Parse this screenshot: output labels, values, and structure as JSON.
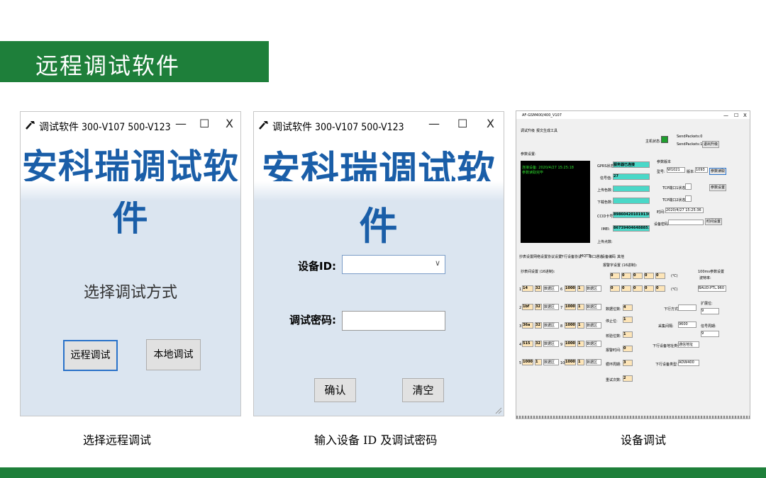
{
  "slide": {
    "title": "远程调试软件",
    "colors": {
      "band": "#1e7f3a",
      "window_bg": "#dbe5f0",
      "banner_text": "#1a5ea8",
      "focus": "#2a72c9"
    }
  },
  "window1": {
    "title": "调试软件  300-V107  500-V123",
    "banner": "安科瑞调试软件",
    "prompt": "选择调试方式",
    "remote_button": "远程调试",
    "local_button": "本地调试",
    "minimize": "—",
    "maximize": "☐",
    "close": "X",
    "icon": "hammer-icon"
  },
  "window2": {
    "title": "调试软件  300-V107  500-V123",
    "banner": "安科瑞调试软件",
    "device_id_label": "设备ID:",
    "device_id_value": "",
    "password_label": "调试密码:",
    "password_value": "",
    "confirm_button": "确认",
    "clear_button": "清空",
    "minimize": "—",
    "maximize": "☐",
    "close": "X"
  },
  "window3": {
    "title": "AF-GSM400/400_V107",
    "menu": [
      "调试升级",
      "报文生成工具"
    ],
    "min": "—",
    "max": "☐",
    "close": "X",
    "host_status_label": "主机状态:",
    "send_packets": "SendPackets:0",
    "send_packets2": "SendPackets:1",
    "exit_button": "退出升级",
    "params_label": "参数设置:",
    "log_line1": "连接设备: 2020/4/27 15:25:18",
    "log_line2": "参数读取完毕",
    "gprs_label": "GPRS状态:",
    "gprs_value": "服务器已连接",
    "signal_label": "信号值:",
    "signal_value": "27",
    "upload_label": "上传色数:",
    "download_label": "下载色数:",
    "ccid_label": "CCID卡号:",
    "ccid_value": "89860420101913C0069200",
    "imei_label": "IMEI:",
    "imei_value": "867394046488851",
    "upload_status_label": "上传点数:",
    "param_section": "参数版本",
    "model_label": "型号:",
    "model_value": "W1021",
    "version_label": "版本:",
    "version_value": "1093",
    "read_params_btn": "参数读取",
    "tcp1_label": "TCP端口1状态:",
    "tcp2_label": "TCP端口2状态:",
    "set_params_btn": "参数设置",
    "time_label": "时间:",
    "time_value": "2020/4/27 15:25:36",
    "device_pw_label": "设备密码:",
    "time_set_btn": "时间设置",
    "tabs": [
      "抄表设置",
      "网络设置",
      "协议设置",
      "下行设备协议",
      "MQTT",
      "串口通道",
      "设备编码",
      "其他"
    ],
    "meter_label": "抄表间设置 (16进制):",
    "alarm_label": "报警字设置 (16进制):",
    "loop_label": "100ms参数设置",
    "rows": [
      {
        "n": "1",
        "a": "14",
        "b": "32",
        "c": "数据区",
        "n2": "6",
        "d": "1000",
        "e": "1",
        "f": "数据区"
      },
      {
        "n": "2",
        "a": "1bf",
        "b": "32",
        "c": "数据区",
        "n2": "7",
        "d": "1000",
        "e": "1",
        "f": "数据区"
      },
      {
        "n": "3",
        "a": "36a",
        "b": "32",
        "c": "数据区",
        "n2": "8",
        "d": "1000",
        "e": "1",
        "f": "数据区"
      },
      {
        "n": "4",
        "a": "515",
        "b": "32",
        "c": "数据区",
        "n2": "9",
        "d": "1000",
        "e": "1",
        "f": "数据区"
      },
      {
        "n": "5",
        "a": "1000",
        "b": "1",
        "c": "数据区",
        "n2": "10",
        "d": "1000",
        "e": "1",
        "f": "数据区"
      }
    ],
    "zeros": [
      "0",
      "0",
      "0",
      "0",
      "0"
    ],
    "unit1": "(℃)",
    "unit2": "(℃)",
    "baud_label": "波特率:",
    "baud_value": "BAUD:PTL.960",
    "data_bits_label": "数据位数:",
    "data_bits_value": "4",
    "stop_bits_label": "停止位:",
    "stop_bits_value": "1",
    "check_label": "校验位数:",
    "check_value": "1",
    "alarm_time_label": "报警时间:",
    "alarm_time_value": "0",
    "dl_label": "下行方式:",
    "ext_label": "扩展位:",
    "ext_value": "9",
    "collect_label": "采集间隔:",
    "collect_value": "9600",
    "sig_label": "信号周期:",
    "sig_value": "9",
    "dl_type_label": "下行设备地址类型:",
    "dl_type_value": "通信地址",
    "dl_dev_label": "下行设备类型:",
    "dl_dev_value": "ADW400",
    "loop_count_label": "循环周期:",
    "loop_count_value": "3",
    "retry_label": "重试次数:",
    "retry_value": "2"
  },
  "captions": {
    "c1": "选择远程调试",
    "c2": "输入设备 ID 及调试密码",
    "c3": "设备调试"
  }
}
